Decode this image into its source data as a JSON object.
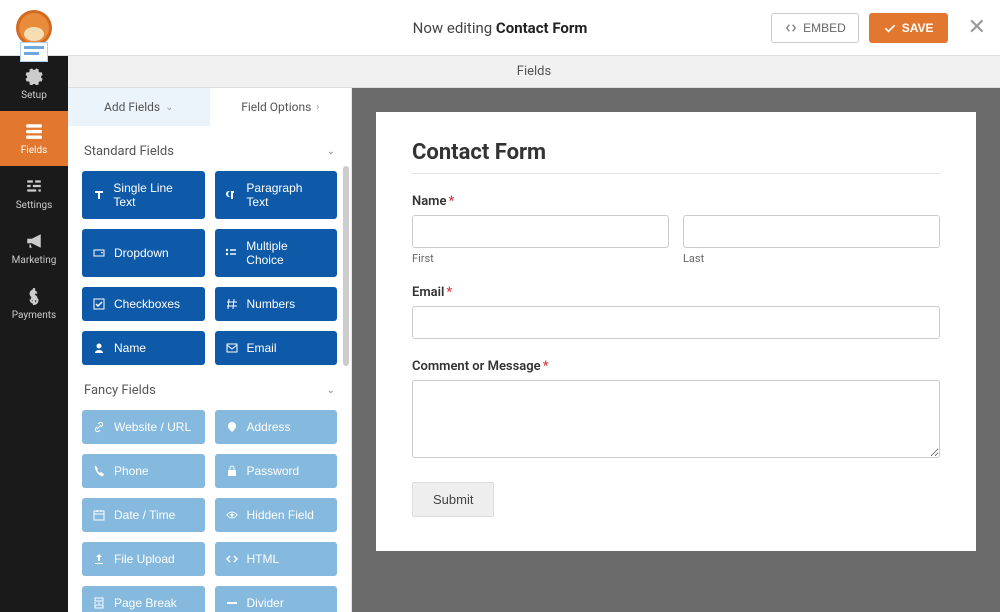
{
  "header": {
    "editing_prefix": "Now editing ",
    "form_name": "Contact Form",
    "embed_label": "EMBED",
    "save_label": "SAVE"
  },
  "section_title": "Fields",
  "sidenav": {
    "items": [
      {
        "label": "Setup"
      },
      {
        "label": "Fields"
      },
      {
        "label": "Settings"
      },
      {
        "label": "Marketing"
      },
      {
        "label": "Payments"
      }
    ]
  },
  "tabs": {
    "add_fields": "Add Fields",
    "field_options": "Field Options"
  },
  "groups": {
    "standard": {
      "title": "Standard Fields",
      "items": [
        {
          "label": "Single Line Text"
        },
        {
          "label": "Paragraph Text"
        },
        {
          "label": "Dropdown"
        },
        {
          "label": "Multiple Choice"
        },
        {
          "label": "Checkboxes"
        },
        {
          "label": "Numbers"
        },
        {
          "label": "Name"
        },
        {
          "label": "Email"
        }
      ]
    },
    "fancy": {
      "title": "Fancy Fields",
      "items": [
        {
          "label": "Website / URL"
        },
        {
          "label": "Address"
        },
        {
          "label": "Phone"
        },
        {
          "label": "Password"
        },
        {
          "label": "Date / Time"
        },
        {
          "label": "Hidden Field"
        },
        {
          "label": "File Upload"
        },
        {
          "label": "HTML"
        },
        {
          "label": "Page Break"
        },
        {
          "label": "Divider"
        }
      ]
    }
  },
  "form": {
    "title": "Contact Form",
    "name_label": "Name",
    "first_sub": "First",
    "last_sub": "Last",
    "email_label": "Email",
    "comment_label": "Comment or Message",
    "submit_label": "Submit"
  }
}
